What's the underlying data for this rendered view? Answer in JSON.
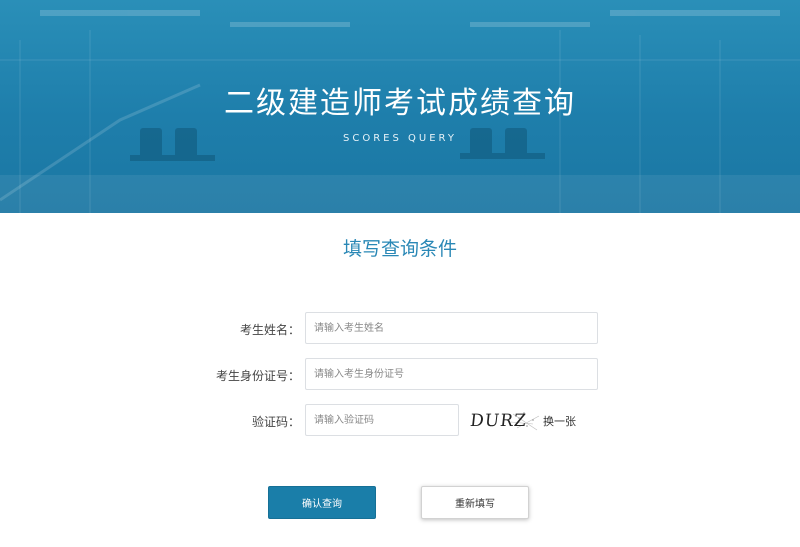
{
  "banner": {
    "title": "二级建造师考试成绩查询",
    "subtitle": "SCORES QUERY",
    "background_color": "#1e7eab"
  },
  "form": {
    "heading": "填写查询条件",
    "fields": [
      {
        "label": "考生姓名：",
        "value": "",
        "placeholder": "请输入考生姓名"
      },
      {
        "label": "考生身份证号：",
        "value": "",
        "placeholder": "请输入考生身份证号"
      },
      {
        "label": "验证码：",
        "value": "",
        "placeholder": "请输入验证码"
      }
    ],
    "captcha": {
      "text": "DURZ",
      "refresh_label": "换一张"
    },
    "submit_label": "确认查询",
    "reset_label": "重新填写"
  },
  "colors": {
    "accent": "#2a88b6",
    "button_primary": "#1a7ea9"
  }
}
